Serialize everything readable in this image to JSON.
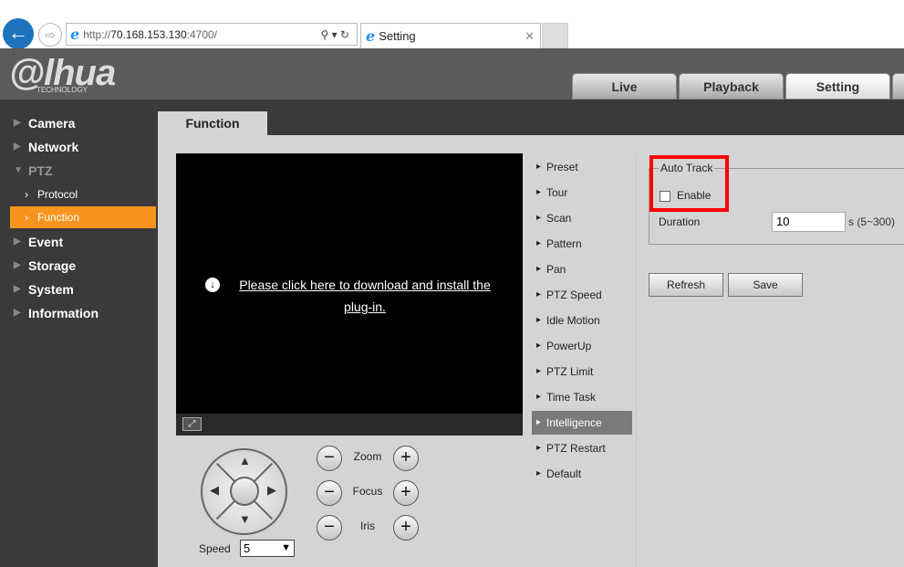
{
  "browser": {
    "url_prefix": "http://",
    "url_host": "70.168.153.130",
    "url_suffix": ":4700/",
    "tab_title": "Setting"
  },
  "header": {
    "logo": "alhua",
    "logo_sub": "TECHNOLOGY",
    "tabs": [
      "Live",
      "Playback",
      "Setting"
    ]
  },
  "sidebar": {
    "items": [
      "Camera",
      "Network",
      "PTZ",
      "Protocol",
      "Function",
      "Event",
      "Storage",
      "System",
      "Information"
    ]
  },
  "content_tab": "Function",
  "video": {
    "plugin_line1": "Please click here to download and install the",
    "plugin_line2": "plug-in."
  },
  "menu": [
    "Preset",
    "Tour",
    "Scan",
    "Pattern",
    "Pan",
    "PTZ Speed",
    "Idle Motion",
    "PowerUp",
    "PTZ Limit",
    "Time Task",
    "Intelligence",
    "PTZ Restart",
    "Default"
  ],
  "auto_track": {
    "legend": "Auto Track",
    "enable_label": "Enable",
    "enable_checked": false,
    "duration_label": "Duration",
    "duration_value": "10",
    "duration_unit": "s (5~300)"
  },
  "buttons": {
    "refresh": "Refresh",
    "save": "Save"
  },
  "ptz_controls": {
    "zoom": "Zoom",
    "focus": "Focus",
    "iris": "Iris",
    "minus": "−",
    "plus": "+",
    "speed_label": "Speed",
    "speed_value": "5"
  }
}
